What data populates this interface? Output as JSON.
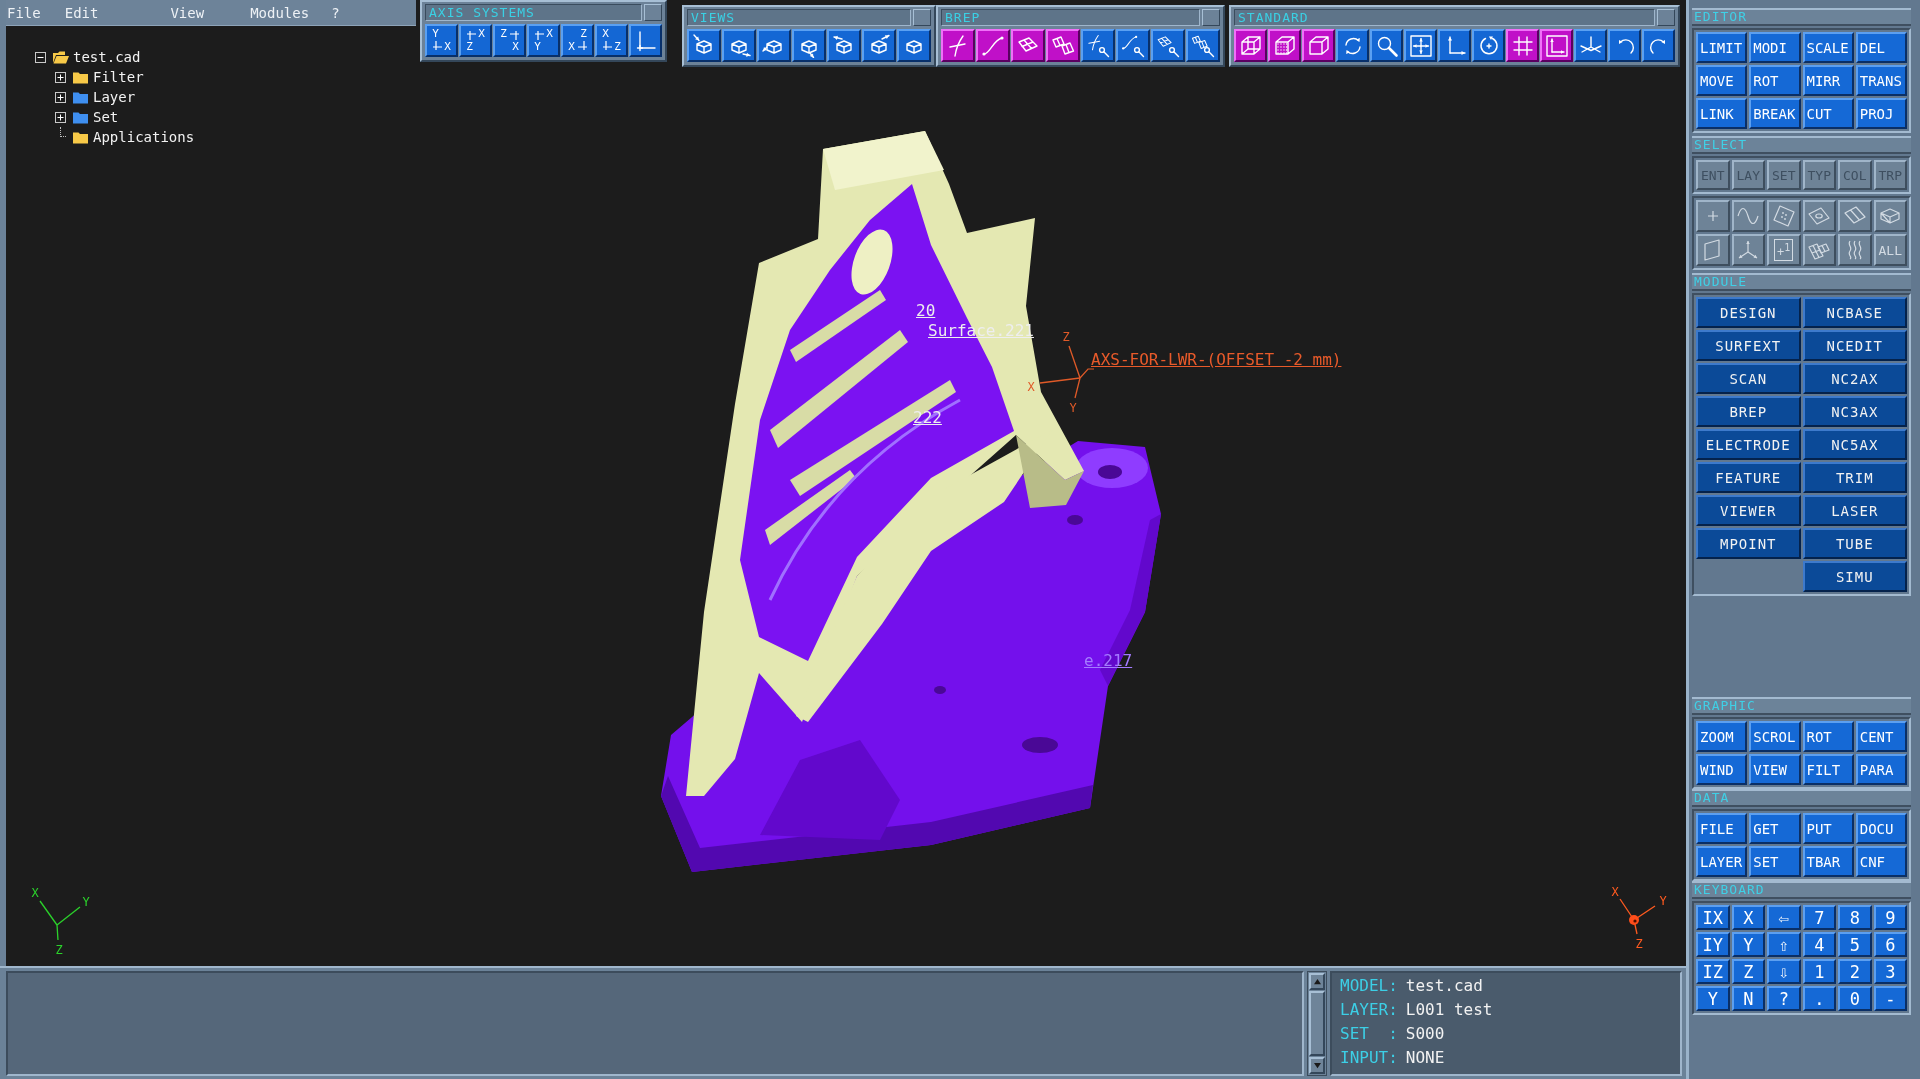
{
  "menu": [
    "File",
    "Edit",
    "View",
    "Modules",
    "?"
  ],
  "tree": [
    {
      "label": "test.cad",
      "kind": "folder",
      "expanded": true,
      "color": "#f7c948",
      "children": [
        {
          "label": "Filter",
          "kind": "folder",
          "expanded": false,
          "color": "#f7c948"
        },
        {
          "label": "Layer",
          "kind": "folder",
          "expanded": false,
          "color": "#3f8ff0"
        },
        {
          "label": "Set",
          "kind": "folder",
          "expanded": false,
          "color": "#3f8ff0"
        },
        {
          "label": "Applications",
          "kind": "leaf",
          "expanded": false,
          "color": "#f7c948"
        }
      ]
    }
  ],
  "toolbars": [
    {
      "title": "AXIS SYSTEMS",
      "kind": "axes",
      "buttons": [
        {
          "kind": "bottomleft",
          "vertical": "Y",
          "horizontal": "X"
        },
        {
          "kind": "topleft",
          "vertical": "Z",
          "horizontal": "X"
        },
        {
          "kind": "topright",
          "vertical": "X",
          "horizontal": "Z"
        },
        {
          "kind": "topleft",
          "vertical": "Y",
          "horizontal": "X"
        },
        {
          "kind": "bottomright",
          "vertical": "Z",
          "horizontal": "X"
        },
        {
          "kind": "bottomleft",
          "vertical": "X",
          "horizontal": "Z"
        },
        {
          "kind": "bottomleft"
        }
      ]
    },
    {
      "title": "VIEWS",
      "kind": "icons",
      "buttons": [
        {
          "kind": "top",
          "active": false
        },
        {
          "kind": "right",
          "active": false
        },
        {
          "kind": "left",
          "active": false
        },
        {
          "kind": "bottom",
          "active": false
        },
        {
          "kind": "back",
          "active": false
        },
        {
          "kind": "topright",
          "active": false
        },
        {
          "kind": "plain",
          "active": false
        }
      ]
    },
    {
      "title": "BREP",
      "kind": "icons",
      "buttons": [
        {
          "kind": "curve",
          "active": true
        },
        {
          "kind": "spline",
          "active": true
        },
        {
          "kind": "patch",
          "active": true
        },
        {
          "kind": "patches",
          "active": true
        },
        {
          "kind": "curvetool",
          "active": false
        },
        {
          "kind": "splinetool",
          "active": false
        },
        {
          "kind": "patchtool",
          "active": false
        },
        {
          "kind": "patchestool",
          "active": false
        }
      ]
    },
    {
      "title": "STANDARD",
      "kind": "icons",
      "buttons": [
        {
          "kind": "wireframe",
          "active": true
        },
        {
          "kind": "shaded",
          "active": true
        },
        {
          "kind": "solid",
          "active": true
        },
        {
          "kind": "refresh",
          "active": false
        },
        {
          "kind": "magnifier",
          "active": false
        },
        {
          "kind": "move",
          "active": false
        },
        {
          "kind": "axes",
          "active": false
        },
        {
          "kind": "rotate",
          "active": false
        },
        {
          "kind": "grid",
          "active": true
        },
        {
          "kind": "corner",
          "active": true
        },
        {
          "kind": "plane",
          "active": false
        },
        {
          "kind": "undo",
          "active": false
        },
        {
          "kind": "redo",
          "active": false
        }
      ]
    }
  ],
  "viewport": {
    "annotations": [
      {
        "kind": "surface",
        "text": "20"
      },
      {
        "kind": "surface",
        "text": "Surface.221"
      },
      {
        "kind": "surface",
        "text": "222"
      },
      {
        "kind": "axis",
        "text": "AXS-FOR-LWR-(OFFSET -2 mm)"
      },
      {
        "kind": "hidden",
        "text": "e.217"
      }
    ],
    "triads": [
      {
        "kind": "part",
        "labels": [
          "Z",
          "X",
          "Y"
        ]
      },
      {
        "kind": "view",
        "labels": [
          "X",
          "Y",
          "Z"
        ]
      },
      {
        "kind": "origin",
        "labels": [
          "X",
          "Y",
          "Z"
        ]
      }
    ]
  },
  "panel": [
    {
      "title": "EDITOR",
      "kind": "command",
      "rows": [
        [
          "LIMIT",
          "MODI",
          "SCALE",
          "DEL"
        ],
        [
          "MOVE",
          "ROT",
          "MIRR",
          "TRANS"
        ],
        [
          "LINK",
          "BREAK",
          "CUT",
          "PROJ"
        ]
      ]
    },
    {
      "title": "SELECT",
      "kind": "select",
      "filters": [
        {
          "label": "ENT",
          "disabled": true
        },
        {
          "label": "LAY",
          "disabled": true
        },
        {
          "label": "SET",
          "disabled": true
        },
        {
          "label": "TYP",
          "disabled": true
        },
        {
          "label": "COL",
          "disabled": true
        },
        {
          "label": "TRP",
          "disabled": true
        }
      ],
      "tools": [
        [
          {
            "kind": "point",
            "disabled": true
          },
          {
            "kind": "curve",
            "disabled": true
          },
          {
            "kind": "surface",
            "disabled": true
          },
          {
            "kind": "hole",
            "disabled": true
          },
          {
            "kind": "edge",
            "disabled": true
          },
          {
            "kind": "box",
            "disabled": true
          }
        ],
        [
          {
            "kind": "face",
            "disabled": true
          },
          {
            "kind": "triad",
            "disabled": true
          },
          {
            "kind": "boxed",
            "label": "+$^{1}$",
            "disabled": true
          },
          {
            "kind": "mesh",
            "disabled": true
          },
          {
            "kind": "waves",
            "disabled": true
          },
          {
            "kind": "text",
            "label": "ALL",
            "disabled": true
          }
        ]
      ]
    },
    {
      "title": "MODULE",
      "kind": "module",
      "columns": [
        [
          "DESIGN",
          "SURFEXT",
          "SCAN",
          "BREP",
          "ELECTRODE",
          "FEATURE",
          "VIEWER",
          "MPOINT"
        ],
        [
          "NCBASE",
          "NCEDIT",
          "NC2AX",
          "NC3AX",
          "NC5AX",
          "TRIM",
          "LASER",
          "TUBE",
          "SIMU"
        ]
      ]
    },
    {
      "title": "GRAPHIC",
      "kind": "command",
      "rows": [
        [
          "ZOOM",
          "SCROL",
          "ROT",
          "CENT"
        ],
        [
          "WIND",
          "VIEW",
          "FILT",
          "PARA"
        ]
      ]
    },
    {
      "title": "DATA",
      "kind": "command",
      "rows": [
        [
          "FILE",
          "GET",
          "PUT",
          "DOCU"
        ],
        [
          "LAYER",
          "SET",
          "TBAR",
          "CNF"
        ]
      ]
    },
    {
      "title": "KEYBOARD",
      "kind": "keyboard",
      "rows": [
        [
          "IX",
          "X",
          "⇦",
          "7",
          "8",
          "9"
        ],
        [
          "IY",
          "Y",
          "⇧",
          "4",
          "5",
          "6"
        ],
        [
          "IZ",
          "Z",
          "⇩",
          "1",
          "2",
          "3"
        ],
        [
          "Y",
          "N",
          "?",
          ".",
          "0",
          "-"
        ]
      ]
    }
  ],
  "status": [
    {
      "label": "MODEL:",
      "value": "test.cad"
    },
    {
      "label": "LAYER:",
      "value": "L001 test"
    },
    {
      "label": "SET  :",
      "value": "S000"
    },
    {
      "label": "INPUT:",
      "value": "NONE"
    }
  ]
}
